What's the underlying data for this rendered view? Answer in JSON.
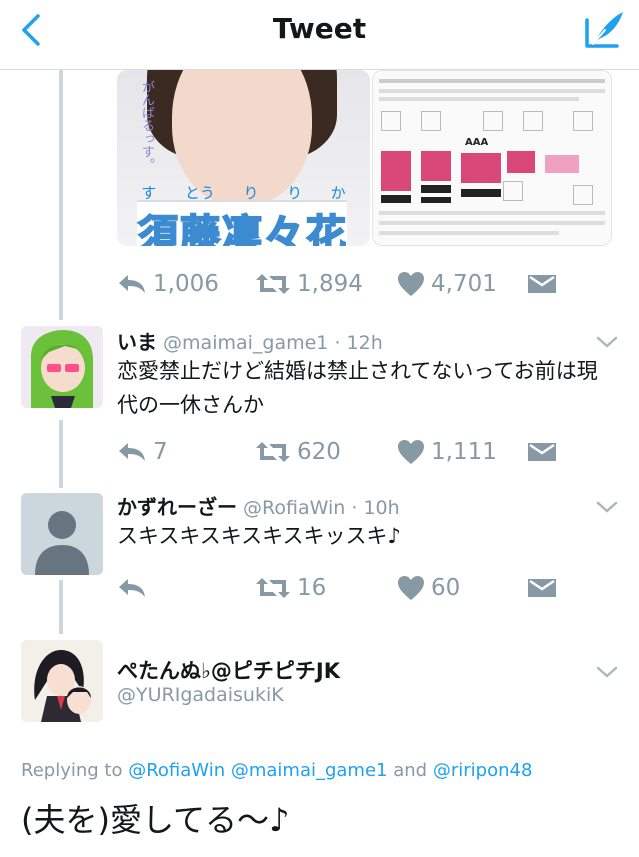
{
  "header": {
    "title": "Tweet",
    "accent": "#1da1f2"
  },
  "top_tweet": {
    "media_portrait_side": "がんばるっす。",
    "media_portrait_ruby": [
      "す",
      "とう",
      "り",
      "り",
      "か"
    ],
    "media_portrait_name": "須藤凜々花",
    "media_flyer_badge": "AAA",
    "replies": "1,006",
    "retweets": "1,894",
    "likes": "4,701"
  },
  "replies": [
    {
      "name": "いま",
      "handle": "@maimai_game1",
      "time": "· 12h",
      "text": "恋愛禁止だけど結婚は禁止されてないってお前は現代の一休さんか",
      "replies": "7",
      "retweets": "620",
      "likes": "1,111"
    },
    {
      "name": "かずれーざー",
      "handle": "@RofiaWin",
      "time": "· 10h",
      "text": "スキスキスキスキスキッスキ♪",
      "replies": "",
      "retweets": "16",
      "likes": "60"
    }
  ],
  "focused": {
    "name": "ぺたんぬ♭@ピチピチJK",
    "handle": "@YURIgadaisukiK",
    "replying_prefix": "Replying to",
    "mentions": [
      "@RofiaWin",
      "@maimai_game1"
    ],
    "and_word": "and",
    "last_mention": "@riripon48",
    "text": "(夫を)愛してる〜♪"
  },
  "colors": {
    "icon_gray": "#8899a6",
    "thread_line": "#ccd6dd",
    "link_blue": "#1da1f2"
  },
  "icons": {
    "back": "chevron-left-icon",
    "compose": "compose-feather-icon",
    "reply": "reply-arrow-icon",
    "retweet": "retweet-icon",
    "like": "heart-icon",
    "dm": "envelope-icon",
    "more": "chevron-down-icon"
  }
}
